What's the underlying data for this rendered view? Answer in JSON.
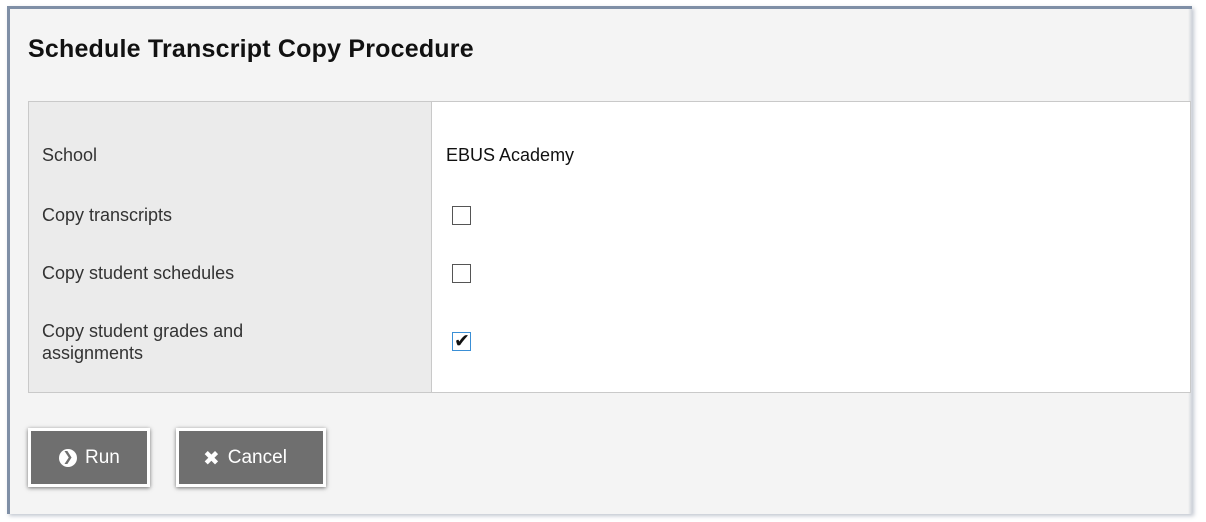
{
  "header": {
    "title": "Schedule Transcript Copy Procedure"
  },
  "form": {
    "fields": [
      {
        "label": "School",
        "value": "EBUS Academy"
      },
      {
        "label": "Copy transcripts",
        "checked": false
      },
      {
        "label": "Copy student schedules",
        "checked": false
      },
      {
        "label": "Copy student grades and assignments",
        "checked": true
      }
    ]
  },
  "actions": {
    "run_label": "Run",
    "cancel_label": "Cancel"
  },
  "icons": {
    "run": "circle-chevron-right-icon",
    "cancel": "x-icon",
    "check": "checkmark-icon"
  },
  "colors": {
    "button_bg": "#6f6f6f",
    "label_column_bg": "#ebebeb",
    "checked_border": "#3a8fd6"
  }
}
